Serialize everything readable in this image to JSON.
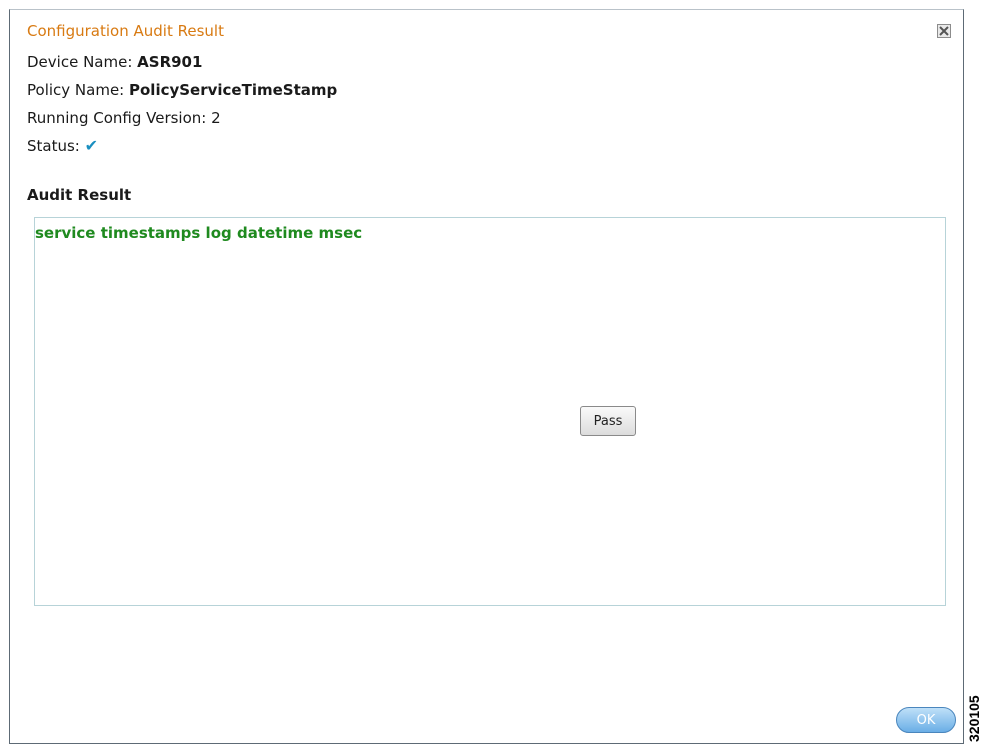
{
  "dialog": {
    "title": "Configuration Audit Result",
    "close_icon": "close-icon",
    "info": {
      "device_label": "Device Name: ",
      "device_value": "ASR901",
      "policy_label": "Policy Name: ",
      "policy_value": "PolicyServiceTimeStamp",
      "version_label": "Running Config Version: ",
      "version_value": "2",
      "status_label": "Status: ",
      "status_icon": "check-icon",
      "status_glyph": "✔"
    },
    "audit": {
      "title": "Audit Result",
      "line": "service timestamps log datetime msec",
      "line_color": "#1f8a1f",
      "pass_label": "Pass"
    },
    "ok_label": "OK"
  },
  "figure_id": "320105",
  "colors": {
    "title": "#d87a12",
    "check": "#1a8fc0",
    "ok_button": "#6aaee6"
  }
}
